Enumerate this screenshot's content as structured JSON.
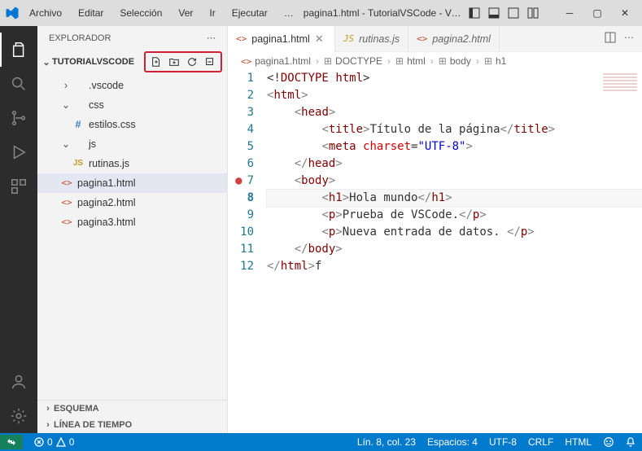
{
  "titlebar": {
    "menus": [
      "Archivo",
      "Editar",
      "Selección",
      "Ver",
      "Ir",
      "Ejecutar",
      "…"
    ],
    "title": "pagina1.html - TutorialVSCode - Vi…"
  },
  "explorer": {
    "header": "EXPLORADOR",
    "project": "TUTORIALVSCODE",
    "items": [
      {
        "label": ".vscode",
        "indent": "depth1",
        "chev": "›",
        "iconClass": "",
        "colorClass": ""
      },
      {
        "label": "css",
        "indent": "depth1",
        "chev": "⌄",
        "iconClass": "",
        "colorClass": ""
      },
      {
        "label": "estilos.css",
        "indent": "depth2",
        "chev": "",
        "iconClass": "#",
        "colorClass": "color-blue"
      },
      {
        "label": "js",
        "indent": "depth1",
        "chev": "⌄",
        "iconClass": "",
        "colorClass": ""
      },
      {
        "label": "rutinas.js",
        "indent": "depth2",
        "chev": "",
        "iconClass": "JS",
        "colorClass": "color-yellow"
      },
      {
        "label": "pagina1.html",
        "indent": "depth1",
        "chev": "",
        "iconClass": "<>",
        "colorClass": "color-red",
        "active": true
      },
      {
        "label": "pagina2.html",
        "indent": "depth1",
        "chev": "",
        "iconClass": "<>",
        "colorClass": "color-red"
      },
      {
        "label": "pagina3.html",
        "indent": "depth1",
        "chev": "",
        "iconClass": "<>",
        "colorClass": "color-red"
      }
    ],
    "bottom": [
      "ESQUEMA",
      "LÍNEA DE TIEMPO"
    ]
  },
  "tabs": [
    {
      "label": "pagina1.html",
      "icon": "<>",
      "iconColor": "color-red",
      "active": true,
      "closable": true
    },
    {
      "label": "rutinas.js",
      "icon": "JS",
      "iconColor": "color-yellow",
      "active": false,
      "closable": false
    },
    {
      "label": "pagina2.html",
      "icon": "<>",
      "iconColor": "color-red",
      "active": false,
      "closable": false
    }
  ],
  "breadcrumb": [
    "pagina1.html",
    "DOCTYPE",
    "html",
    "body",
    "h1"
  ],
  "code": {
    "lines": 12,
    "line1": {
      "doctype": "DOCTYPE",
      "html": "html"
    },
    "line2": {
      "tag": "html"
    },
    "line3": {
      "tag": "head"
    },
    "line4": {
      "tag": "title",
      "text": "Título de la página"
    },
    "line5": {
      "tag": "meta",
      "attr": "charset",
      "val": "\"UTF-8\""
    },
    "line6": {
      "tag": "head"
    },
    "line7": {
      "tag": "body"
    },
    "line8": {
      "tag": "h1",
      "text": "Hola mundo"
    },
    "line9": {
      "tag": "p",
      "text": "Prueba de VSCode."
    },
    "line10": {
      "tag": "p",
      "text": "Nueva entrada de datos. "
    },
    "line11": {
      "tag": "body"
    },
    "line12": {
      "tag": "html",
      "suffix": "f"
    }
  },
  "status": {
    "errors": "0",
    "warnings": "0",
    "line_col": "Lín. 8, col. 23",
    "spaces": "Espacios: 4",
    "encoding": "UTF-8",
    "eol": "CRLF",
    "lang": "HTML"
  }
}
